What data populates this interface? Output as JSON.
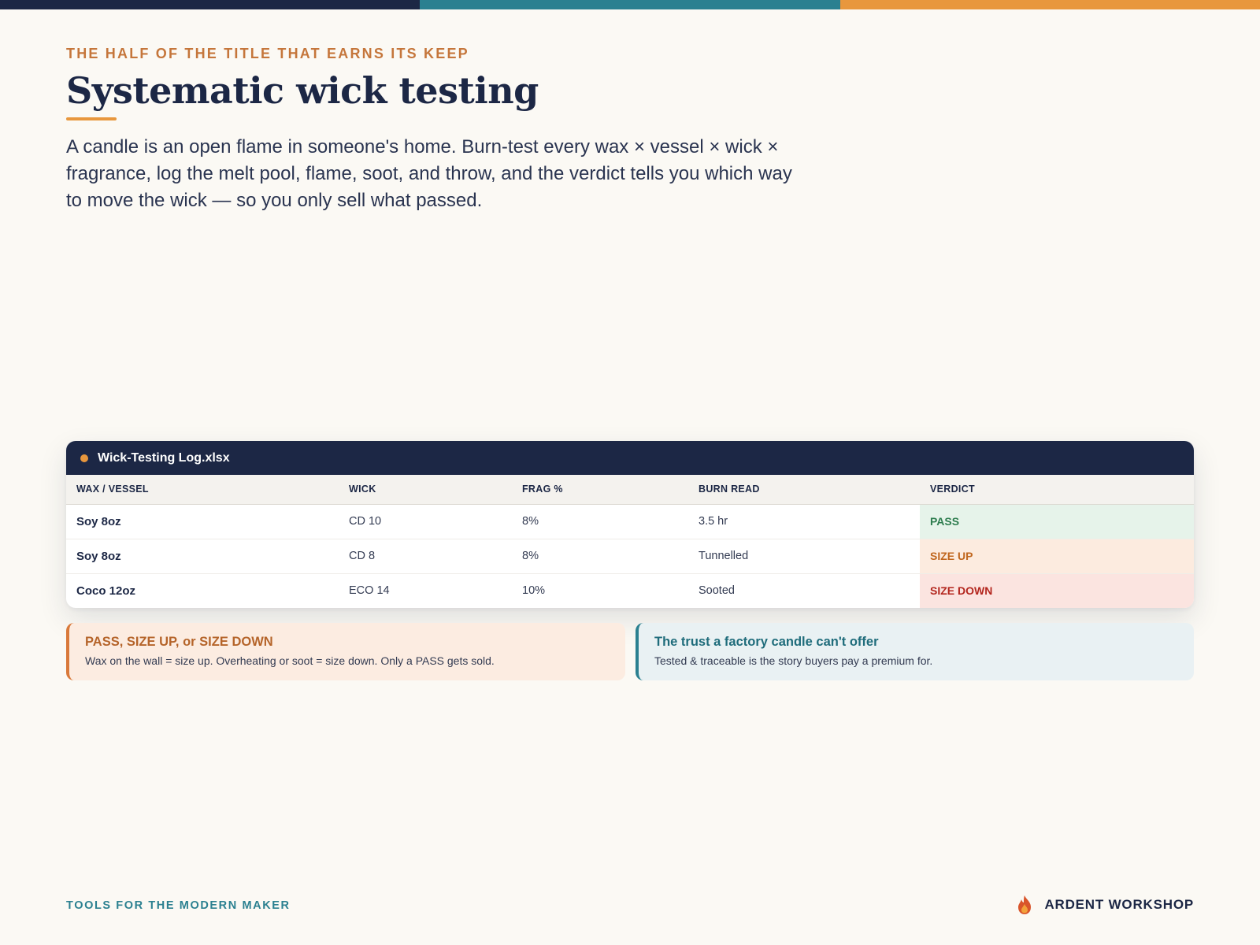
{
  "brand_colors": [
    "#1c2745",
    "#2b8090",
    "#e8973d"
  ],
  "eyebrow": "THE HALF OF THE TITLE THAT EARNS ITS KEEP",
  "title": "Systematic wick testing",
  "lede": "A candle is an open flame in someone's home. Burn-test every wax × vessel × wick × fragrance, log the melt pool, flame, soot, and throw, and the verdict tells you which way to move the wick — so you only sell what passed.",
  "sheet": {
    "filename": "Wick-Testing Log.xlsx",
    "headers": [
      "WAX / VESSEL",
      "WICK",
      "FRAG %",
      "BURN READ",
      "VERDICT"
    ],
    "rows": [
      {
        "wax_vessel": "Soy 8oz",
        "wick": "CD 10",
        "frag": "8%",
        "burn_read": "3.5 hr",
        "verdict": "PASS"
      },
      {
        "wax_vessel": "Soy 8oz",
        "wick": "CD 8",
        "frag": "8%",
        "burn_read": "Tunnelled",
        "verdict": "SIZE UP"
      },
      {
        "wax_vessel": "Coco 12oz",
        "wick": "ECO 14",
        "frag": "10%",
        "burn_read": "Sooted",
        "verdict": "SIZE DOWN"
      }
    ]
  },
  "callouts": [
    {
      "title": "PASS, SIZE UP, or SIZE DOWN",
      "body": "Wax on the wall = size up. Overheating or soot = size down. Only a PASS gets sold."
    },
    {
      "title": "The trust a factory candle can't offer",
      "body": "Tested & traceable is the story buyers pay a premium for."
    }
  ],
  "footer": {
    "tagline": "TOOLS FOR THE MODERN MAKER",
    "brand": "ARDENT WORKSHOP",
    "brand_icon": "flame-icon"
  }
}
